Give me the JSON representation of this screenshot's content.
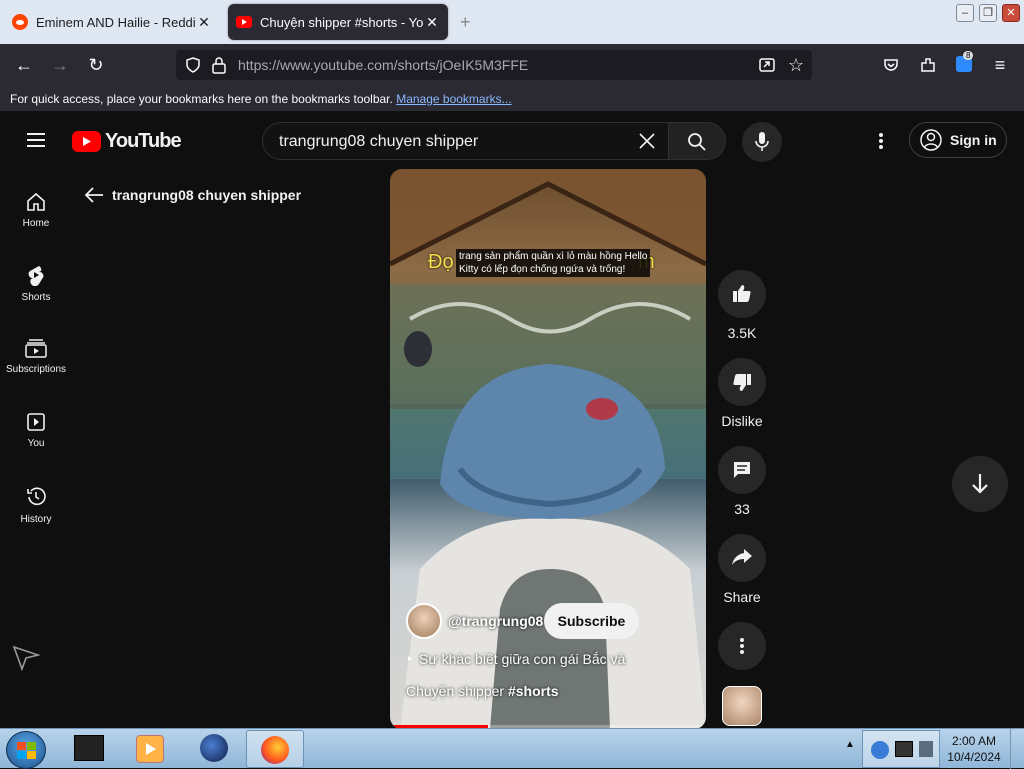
{
  "tabs": [
    {
      "title": "Eminem AND Hailie - Reddit Se",
      "close": "✕"
    },
    {
      "title": "Chuyện shipper #shorts - YouTu",
      "close": "✕"
    }
  ],
  "new_tab": "+",
  "address": "https://www.youtube.com/shorts/jOeIK5M3FFE",
  "extension_badge": "8",
  "bookmarks_bar": {
    "text": "For quick access, place your bookmarks here on the bookmarks toolbar.",
    "link": "Manage bookmarks..."
  },
  "youtube": {
    "logo": "YouTube",
    "search_value": "trangrung08 chuyen shipper",
    "signin": "Sign in",
    "back_title": "trangrung08 chuyen shipper",
    "sidebar": [
      {
        "label": "Home",
        "icon": "home-icon"
      },
      {
        "label": "Shorts",
        "icon": "shorts-icon"
      },
      {
        "label": "Subscriptions",
        "icon": "subscriptions-icon"
      },
      {
        "label": "You",
        "icon": "you-icon"
      },
      {
        "label": "History",
        "icon": "history-icon"
      }
    ],
    "video": {
      "caption_line1": "trang sản phẩm quần xì lỏ màu hồng Hello",
      "caption_line2": "Kitty có lếp đọn chống ngứa và trống!",
      "caption_bg_left": "Đọ",
      "caption_bg_right": "m",
      "channel": "@trangrung08",
      "subscribe": "Subscribe",
      "desc_line1": "Sự khác biệt giữa con gái Bắc và",
      "desc_line2_prefix": "Chuyện shipper ",
      "desc_line2_tag": "#shorts",
      "progress": 0.31
    },
    "actions": {
      "likes": "3.5K",
      "dislike": "Dislike",
      "comments": "33",
      "share": "Share"
    }
  },
  "taskbar": {
    "time": "2:00 AM",
    "date": "10/4/2024"
  },
  "colors": {
    "yt_red": "#ff0000",
    "bg": "#0f0f0f",
    "link": "#8bb8ff"
  }
}
